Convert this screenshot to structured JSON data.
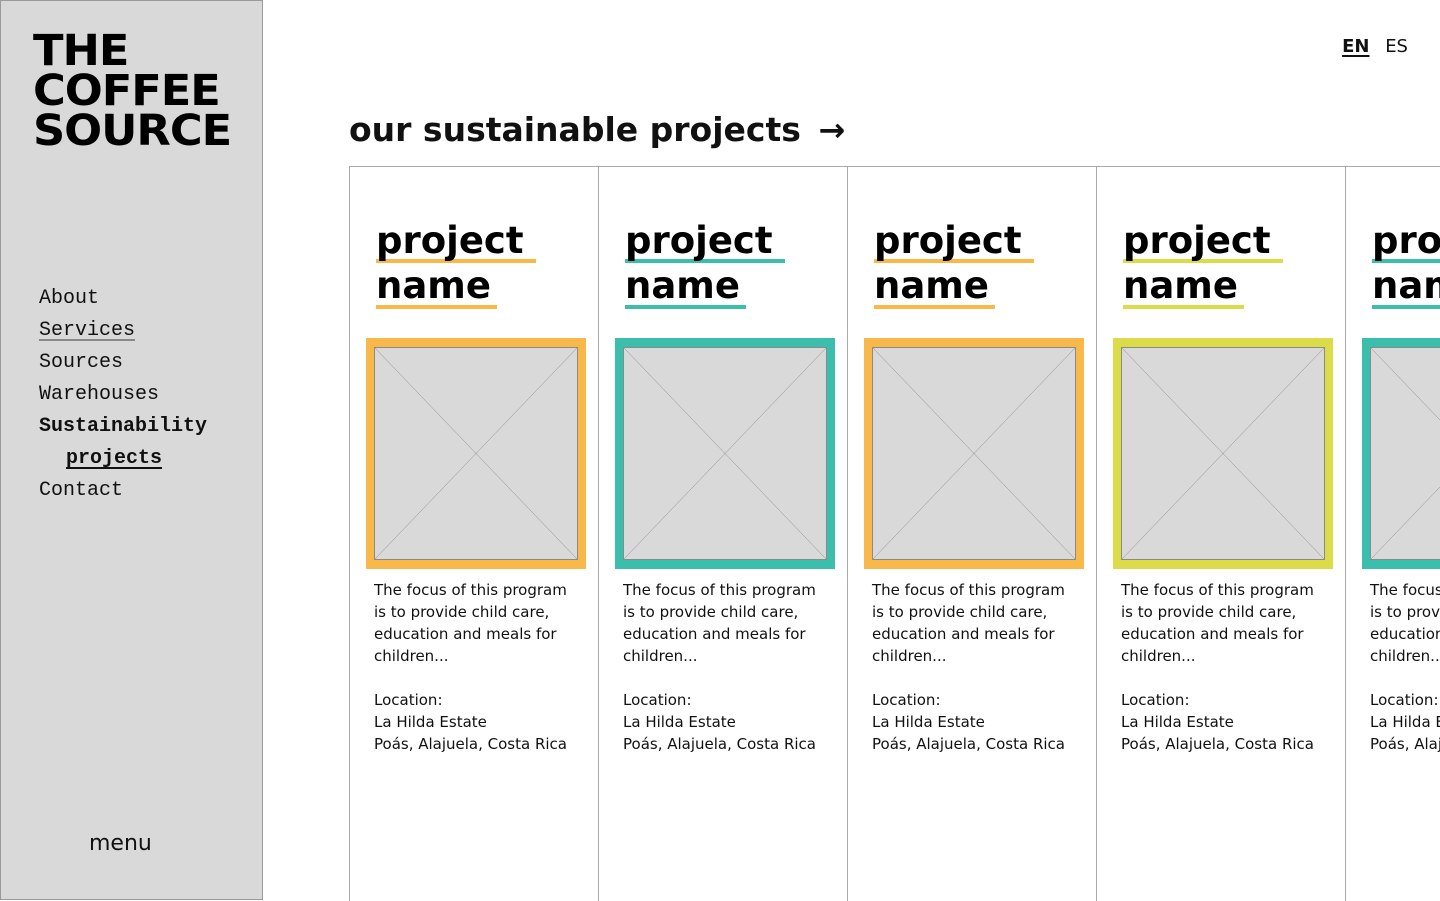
{
  "brand": {
    "line1": "THE",
    "line2": "COFFEE",
    "line3": "SOURCE"
  },
  "nav": {
    "items": [
      {
        "label": "About"
      },
      {
        "label": "Services"
      },
      {
        "label": "Sources"
      },
      {
        "label": "Warehouses"
      },
      {
        "label": "Sustainability"
      },
      {
        "label": "projects"
      },
      {
        "label": "Contact"
      }
    ],
    "menu_label": "menu"
  },
  "language": {
    "en": "EN",
    "es": "ES"
  },
  "page": {
    "title": "our sustainable projects",
    "arrow": "→"
  },
  "colors": {
    "orange": "#f9b84a",
    "teal": "#3bbfac",
    "yellow": "#dcdc4a",
    "sidebar": "#d9d9d9"
  },
  "cards": [
    {
      "name1": "project",
      "name2": "name",
      "accent": "#f9b84a",
      "desc1": "The focus of this program",
      "desc2": "is to provide child care,",
      "desc3": "education and meals for",
      "desc4": "children...",
      "loc_label": "Location:",
      "loc1": "La Hilda Estate",
      "loc2": "Poás, Alajuela, Costa Rica"
    },
    {
      "name1": "project",
      "name2": "name",
      "accent": "#3bbfac",
      "desc1": "The focus of this program",
      "desc2": "is to provide child care,",
      "desc3": "education and meals for",
      "desc4": "children...",
      "loc_label": "Location:",
      "loc1": "La Hilda Estate",
      "loc2": "Poás, Alajuela, Costa Rica"
    },
    {
      "name1": "project",
      "name2": "name",
      "accent": "#f9b84a",
      "desc1": "The focus of this program",
      "desc2": "is to provide child care,",
      "desc3": "education and meals for",
      "desc4": "children...",
      "loc_label": "Location:",
      "loc1": "La Hilda Estate",
      "loc2": "Poás, Alajuela, Costa Rica"
    },
    {
      "name1": "project",
      "name2": "name",
      "accent": "#dcdc4a",
      "desc1": "The focus of this program",
      "desc2": "is to provide child care,",
      "desc3": "education and meals for",
      "desc4": "children...",
      "loc_label": "Location:",
      "loc1": "La Hilda Estate",
      "loc2": "Poás, Alajuela, Costa Rica"
    },
    {
      "name1": "project",
      "name2": "name",
      "accent": "#3bbfac",
      "desc1": "The focus of this program",
      "desc2": "is to provide child care,",
      "desc3": "education and meals for",
      "desc4": "children...",
      "loc_label": "Location:",
      "loc1": "La Hilda Estate",
      "loc2": "Poás, Alajuela, Costa Rica"
    }
  ]
}
